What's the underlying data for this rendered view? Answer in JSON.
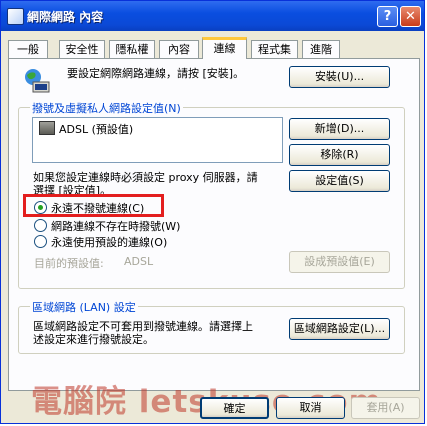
{
  "window": {
    "title": "網際網路 內容"
  },
  "titlebar": {
    "help_glyph": "?",
    "close_glyph": "✕"
  },
  "tabs": [
    "一般",
    "安全性",
    "隱私權",
    "內容",
    "連線",
    "程式集",
    "進階"
  ],
  "active_tab": "連線",
  "setup": {
    "text": "要設定網際網路連線，請按 [安裝]。",
    "button": "安裝(U)..."
  },
  "dialup": {
    "group_label": "撥號及虛擬私人網路設定值(N)",
    "connections": [
      {
        "name": "ADSL (預設值)",
        "icon": "dialup-connection-icon"
      }
    ],
    "add_button": "新增(D)...",
    "remove_button": "移除(R)",
    "settings_button": "設定值(S)",
    "proxy_note_line1": "如果您設定連線時必須設定 proxy 伺服器，請",
    "proxy_note_line2": "選擇 [設定值]。",
    "options": [
      {
        "label": "永遠不撥號連線(C)",
        "selected": true
      },
      {
        "label": "網路連線不存在時撥號(W)",
        "selected": false
      },
      {
        "label": "永遠使用預設的連線(O)",
        "selected": false
      }
    ],
    "default_label": "目前的預設值:",
    "default_value": "ADSL",
    "set_default_button": "設成預設值(E)"
  },
  "lan": {
    "group_label": "區域網路 (LAN) 設定",
    "text_line1": "區域網路設定不可套用到撥號連線。請選擇上",
    "text_line2": "述設定來進行撥號設定。",
    "button": "區域網路設定(L)..."
  },
  "footer": {
    "ok": "確定",
    "cancel": "取消",
    "apply": "套用(A)"
  },
  "watermark": "電腦院 letskuso.com",
  "colors": {
    "titlebar": "#0a4ee0",
    "highlight": "#e31e1e",
    "group_label": "#0046d5"
  }
}
